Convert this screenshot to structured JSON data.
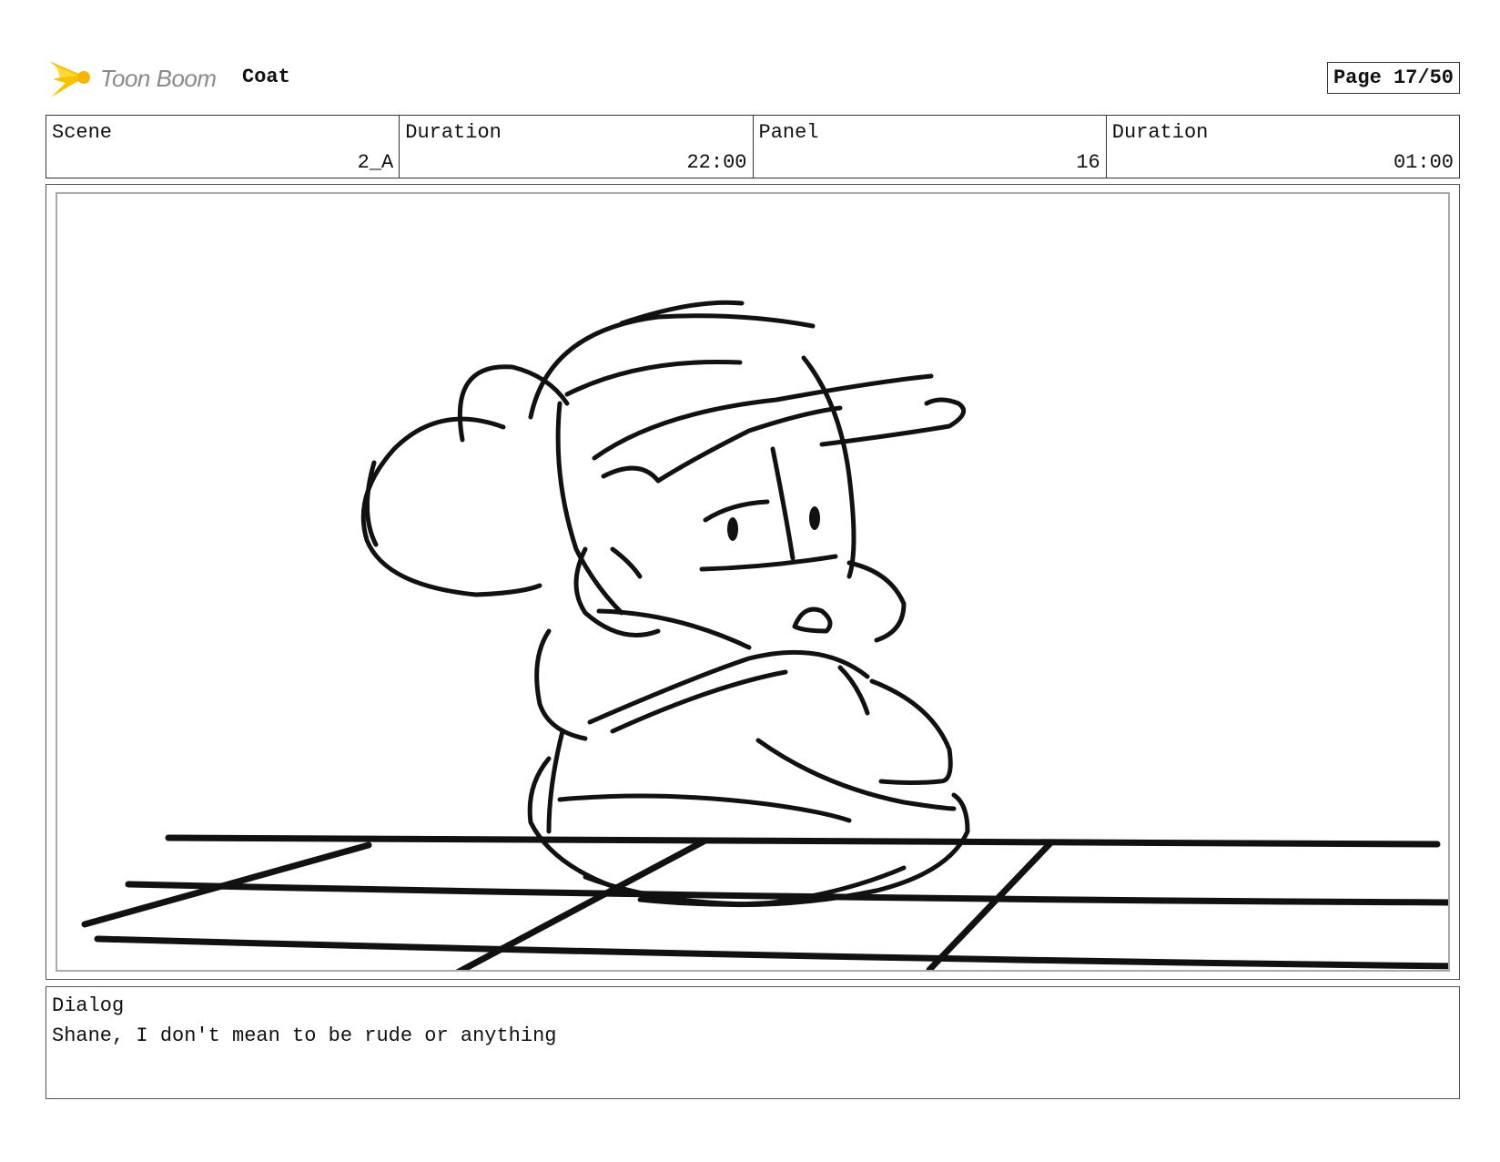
{
  "header": {
    "logo_text": "Toon Boom",
    "project_title": "Coat",
    "page_label": "Page 17/50"
  },
  "info": {
    "scene_label": "Scene",
    "scene_value": "2_A",
    "scene_duration_label": "Duration",
    "scene_duration_value": "22:00",
    "panel_label": "Panel",
    "panel_value": "16",
    "panel_duration_label": "Duration",
    "panel_duration_value": "01:00"
  },
  "dialog": {
    "label": "Dialog",
    "text": "Shane, I don't mean to be rude or anything"
  },
  "colors": {
    "logo_yellow": "#f5c400",
    "logo_gray": "#8a8a8a",
    "ink": "#111111"
  },
  "icons": {
    "logo": "toon-boom-star-icon"
  }
}
